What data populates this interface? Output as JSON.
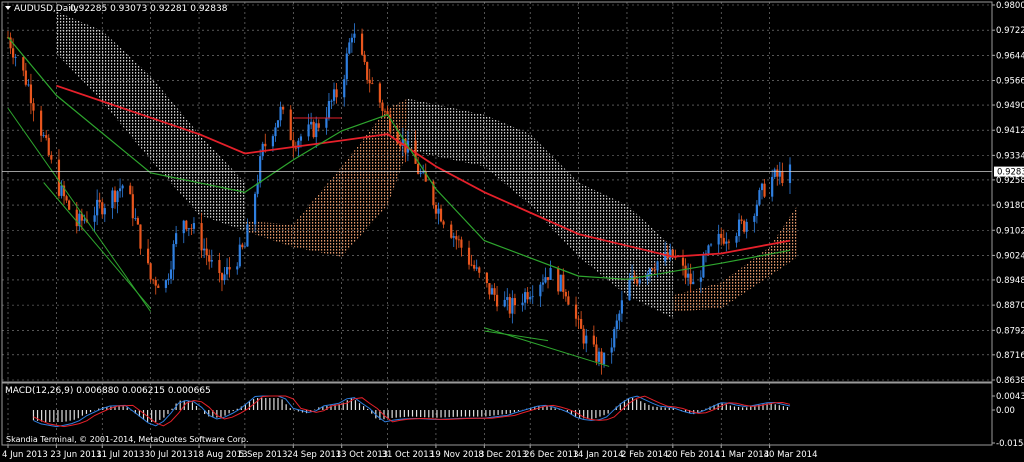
{
  "colors": {
    "background": "#000000",
    "bull": "#2f7fe0",
    "bear": "#e8561e",
    "ma_red": "#e6202a",
    "ma_green": "#2ea62e",
    "cloud_light": "#d8d8d8",
    "cloud_orange": "#f0a070",
    "macd_hist": "#e0e0e0",
    "macd_main": "#2f7fe0",
    "macd_signal": "#e6202a",
    "price_tag": "#ffffff"
  },
  "window": {
    "title_icon": "dropdown-triangle-icon",
    "symbol_label": "AUDUSD,Daily",
    "ohlc": "0.92285 0.93073 0.92281 0.92838"
  },
  "macd": {
    "label": "MACD(12,26,9) 0.006880 0.006215 0.000665",
    "axis": [
      "0.00433",
      "0.00",
      "-0.01545"
    ]
  },
  "copyright": "Skandia Terminal, © 2001-2014, MetaQuotes Software Corp.",
  "chart_data": {
    "type": "candlestick",
    "symbol": "AUDUSD",
    "timeframe": "Daily",
    "last_price": 0.92838,
    "x_range": [
      "4 Jun 2013",
      "7 Apr 2014"
    ],
    "ylim": [
      0.8638,
      0.98
    ],
    "y_ticks": [
      "0.98000",
      "0.97220",
      "0.96440",
      "0.95660",
      "0.94900",
      "0.94120",
      "0.93340",
      "0.92580",
      "0.91800",
      "0.91020",
      "0.90240",
      "0.89480",
      "0.88700",
      "0.87920",
      "0.87160",
      "0.86380"
    ],
    "x_ticks": [
      "4 Jun 2013",
      "23 Jun 2013",
      "11 Jul 2013",
      "30 Jul 2013",
      "18 Aug 2013",
      "5 Sep 2013",
      "24 Sep 2013",
      "13 Oct 2013",
      "31 Oct 2013",
      "19 Nov 2013",
      "8 Dec 2013",
      "26 Dec 2013",
      "14 Jan 2014",
      "2 Feb 2014",
      "20 Feb 2014",
      "11 Mar 2014",
      "30 Mar 2014"
    ],
    "price_anchors": [
      {
        "date": "4 Jun 2013",
        "close": 0.97
      },
      {
        "date": "12 Jun 2013",
        "close": 0.955
      },
      {
        "date": "23 Jun 2013",
        "close": 0.925
      },
      {
        "date": "1 Jul 2013",
        "close": 0.912
      },
      {
        "date": "11 Jul 2013",
        "close": 0.918
      },
      {
        "date": "20 Jul 2013",
        "close": 0.925
      },
      {
        "date": "30 Jul 2013",
        "close": 0.895
      },
      {
        "date": "5 Aug 2013",
        "close": 0.894
      },
      {
        "date": "11 Aug 2013",
        "close": 0.915
      },
      {
        "date": "18 Aug 2013",
        "close": 0.908
      },
      {
        "date": "26 Aug 2013",
        "close": 0.894
      },
      {
        "date": "5 Sep 2013",
        "close": 0.905
      },
      {
        "date": "12 Sep 2013",
        "close": 0.935
      },
      {
        "date": "19 Sep 2013",
        "close": 0.947
      },
      {
        "date": "24 Sep 2013",
        "close": 0.938
      },
      {
        "date": "3 Oct 2013",
        "close": 0.942
      },
      {
        "date": "13 Oct 2013",
        "close": 0.955
      },
      {
        "date": "17 Oct 2013",
        "close": 0.972
      },
      {
        "date": "22 Oct 2013",
        "close": 0.96
      },
      {
        "date": "31 Oct 2013",
        "close": 0.945
      },
      {
        "date": "8 Nov 2013",
        "close": 0.935
      },
      {
        "date": "19 Nov 2013",
        "close": 0.918
      },
      {
        "date": "29 Nov 2013",
        "close": 0.905
      },
      {
        "date": "8 Dec 2013",
        "close": 0.893
      },
      {
        "date": "18 Dec 2013",
        "close": 0.886
      },
      {
        "date": "26 Dec 2013",
        "close": 0.892
      },
      {
        "date": "2 Jan 2014",
        "close": 0.897
      },
      {
        "date": "9 Jan 2014",
        "close": 0.892
      },
      {
        "date": "14 Jan 2014",
        "close": 0.88
      },
      {
        "date": "20 Jan 2014",
        "close": 0.872
      },
      {
        "date": "25 Jan 2014",
        "close": 0.869
      },
      {
        "date": "2 Feb 2014",
        "close": 0.893
      },
      {
        "date": "12 Feb 2014",
        "close": 0.9
      },
      {
        "date": "20 Feb 2014",
        "close": 0.902
      },
      {
        "date": "28 Feb 2014",
        "close": 0.893
      },
      {
        "date": "6 Mar 2014",
        "close": 0.903
      },
      {
        "date": "11 Mar 2014",
        "close": 0.908
      },
      {
        "date": "20 Mar 2014",
        "close": 0.912
      },
      {
        "date": "30 Mar 2014",
        "close": 0.926
      },
      {
        "date": "7 Apr 2014",
        "close": 0.928
      }
    ],
    "moving_averages": [
      {
        "color": "red",
        "points": [
          {
            "date": "23 Jun 2013",
            "value": 0.955
          },
          {
            "date": "18 Aug 2013",
            "value": 0.94
          },
          {
            "date": "5 Sep 2013",
            "value": 0.934
          },
          {
            "date": "13 Oct 2013",
            "value": 0.938
          },
          {
            "date": "31 Oct 2013",
            "value": 0.94
          },
          {
            "date": "19 Nov 2013",
            "value": 0.93
          },
          {
            "date": "8 Dec 2013",
            "value": 0.922
          },
          {
            "date": "14 Jan 2014",
            "value": 0.909
          },
          {
            "date": "20 Feb 2014",
            "value": 0.902
          },
          {
            "date": "11 Mar 2014",
            "value": 0.903
          },
          {
            "date": "7 Apr 2014",
            "value": 0.907
          }
        ]
      },
      {
        "color": "green",
        "points": [
          {
            "date": "4 Jun 2013",
            "value": 0.97
          },
          {
            "date": "23 Jun 2013",
            "value": 0.952
          },
          {
            "date": "30 Jul 2013",
            "value": 0.928
          },
          {
            "date": "5 Sep 2013",
            "value": 0.922
          },
          {
            "date": "24 Sep 2013",
            "value": 0.932
          },
          {
            "date": "13 Oct 2013",
            "value": 0.941
          },
          {
            "date": "31 Oct 2013",
            "value": 0.946
          },
          {
            "date": "19 Nov 2013",
            "value": 0.923
          },
          {
            "date": "8 Dec 2013",
            "value": 0.907
          },
          {
            "date": "14 Jan 2014",
            "value": 0.896
          },
          {
            "date": "2 Feb 2014",
            "value": 0.895
          },
          {
            "date": "11 Mar 2014",
            "value": 0.9
          },
          {
            "date": "7 Apr 2014",
            "value": 0.904
          }
        ]
      }
    ],
    "clouds": [
      {
        "color": "light",
        "upper": [
          {
            "date": "23 Jun 2013",
            "value": 0.978
          },
          {
            "date": "11 Jul 2013",
            "value": 0.972
          },
          {
            "date": "30 Jul 2013",
            "value": 0.958
          },
          {
            "date": "18 Aug 2013",
            "value": 0.94
          },
          {
            "date": "5 Sep 2013",
            "value": 0.925
          }
        ],
        "lower": [
          {
            "date": "23 Jun 2013",
            "value": 0.965
          },
          {
            "date": "11 Jul 2013",
            "value": 0.95
          },
          {
            "date": "30 Jul 2013",
            "value": 0.932
          },
          {
            "date": "18 Aug 2013",
            "value": 0.915
          },
          {
            "date": "5 Sep 2013",
            "value": 0.91
          }
        ]
      },
      {
        "color": "orange",
        "upper": [
          {
            "date": "5 Sep 2013",
            "value": 0.913
          },
          {
            "date": "24 Sep 2013",
            "value": 0.912
          },
          {
            "date": "13 Oct 2013",
            "value": 0.93
          },
          {
            "date": "31 Oct 2013",
            "value": 0.948
          },
          {
            "date": "8 Nov 2013",
            "value": 0.951
          }
        ],
        "lower": [
          {
            "date": "5 Sep 2013",
            "value": 0.91
          },
          {
            "date": "24 Sep 2013",
            "value": 0.905
          },
          {
            "date": "13 Oct 2013",
            "value": 0.902
          },
          {
            "date": "31 Oct 2013",
            "value": 0.918
          },
          {
            "date": "8 Nov 2013",
            "value": 0.935
          }
        ]
      },
      {
        "color": "light",
        "upper": [
          {
            "date": "8 Nov 2013",
            "value": 0.951
          },
          {
            "date": "8 Dec 2013",
            "value": 0.946
          },
          {
            "date": "26 Dec 2013",
            "value": 0.94
          },
          {
            "date": "14 Jan 2014",
            "value": 0.925
          },
          {
            "date": "2 Feb 2014",
            "value": 0.918
          },
          {
            "date": "20 Feb 2014",
            "value": 0.905
          }
        ],
        "lower": [
          {
            "date": "8 Nov 2013",
            "value": 0.935
          },
          {
            "date": "8 Dec 2013",
            "value": 0.93
          },
          {
            "date": "26 Dec 2013",
            "value": 0.918
          },
          {
            "date": "14 Jan 2014",
            "value": 0.902
          },
          {
            "date": "2 Feb 2014",
            "value": 0.89
          },
          {
            "date": "20 Feb 2014",
            "value": 0.883
          }
        ]
      },
      {
        "color": "orange",
        "upper": [
          {
            "date": "20 Feb 2014",
            "value": 0.89
          },
          {
            "date": "11 Mar 2014",
            "value": 0.894
          },
          {
            "date": "30 Mar 2014",
            "value": 0.905
          },
          {
            "date": "10 Apr 2014",
            "value": 0.918
          }
        ],
        "lower": [
          {
            "date": "20 Feb 2014",
            "value": 0.885
          },
          {
            "date": "11 Mar 2014",
            "value": 0.886
          },
          {
            "date": "30 Mar 2014",
            "value": 0.896
          },
          {
            "date": "10 Apr 2014",
            "value": 0.902
          }
        ]
      }
    ],
    "trendlines": [
      {
        "color": "green",
        "from": {
          "date": "4 Jun 2013",
          "value": 0.948
        },
        "to": {
          "date": "30 Jul 2013",
          "value": 0.885
        }
      },
      {
        "color": "green",
        "from": {
          "date": "18 Jun 2013",
          "value": 0.925
        },
        "to": {
          "date": "30 Jul 2013",
          "value": 0.886
        }
      },
      {
        "color": "green",
        "from": {
          "date": "8 Dec 2013",
          "value": 0.88
        },
        "to": {
          "date": "26 Jan 2014",
          "value": 0.868
        }
      },
      {
        "color": "green",
        "from": {
          "date": "8 Dec 2013",
          "value": 0.879
        },
        "to": {
          "date": "2 Jan 2014",
          "value": 0.876
        }
      },
      {
        "color": "red",
        "from": {
          "date": "24 Sep 2013",
          "value": 0.945
        },
        "to": {
          "date": "13 Oct 2013",
          "value": 0.945
        }
      }
    ],
    "last_price_label": "0.92838"
  }
}
